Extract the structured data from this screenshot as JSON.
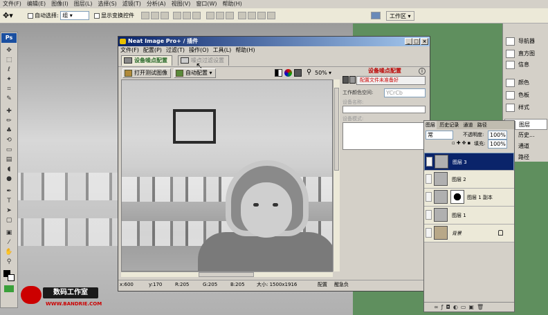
{
  "app": {
    "menu": [
      "文件(F)",
      "编辑(E)",
      "图像(I)",
      "图层(L)",
      "选择(S)",
      "滤镜(T)",
      "分析(A)",
      "视图(V)",
      "窗口(W)",
      "帮助(H)"
    ]
  },
  "options_bar": {
    "auto_select_label": "自动选择:",
    "auto_select_value": "组",
    "show_transform_label": "显示变换控件",
    "workspace_label": "工作区"
  },
  "toolbox": {
    "logo": "Ps"
  },
  "dialog": {
    "title": "Neat Image Pro+ / 插件",
    "menu": [
      "文件(F)",
      "配置(P)",
      "过滤(T)",
      "操作(O)",
      "工具(L)",
      "帮助(H)"
    ],
    "tabs": [
      {
        "label": "设备噪点配置",
        "active": true
      },
      {
        "label": "噪点过滤设置",
        "active": false
      }
    ],
    "toolbar": {
      "open_label": "打开测试图像",
      "auto_profile_label": "自动配置",
      "zoom": "50%"
    },
    "right_panel": {
      "header": "设备噪点配置",
      "status": "配置文件未准备好",
      "color_space_label": "工作颜色空间:",
      "color_space_value": "YCrCb",
      "device_name_label": "设备名称:",
      "device_mode_label": "设备模式:"
    },
    "status_bar": {
      "x": "x:600",
      "y": "y:170",
      "r": "R:205",
      "g": "G:205",
      "b": "B:205",
      "size": "大小: 1500x1916",
      "profile": "配置",
      "filter": "醒急负"
    }
  },
  "dock": {
    "items": [
      "导航器",
      "直方图",
      "信息",
      "颜色",
      "色板",
      "样式",
      "图层",
      "历史...",
      "通道",
      "路径"
    ]
  },
  "layers_panel": {
    "tabs": [
      "图层",
      "历史记录",
      "通道",
      "路径"
    ],
    "blend_mode": "常",
    "opacity_label": "不透明度:",
    "opacity": "100%",
    "fill_label": "填充:",
    "fill": "100%",
    "layers": [
      {
        "name": "图层 3",
        "selected": true
      },
      {
        "name": "图层 2",
        "selected": false
      },
      {
        "name": "图层 1 副本",
        "selected": false
      },
      {
        "name": "图层 1",
        "selected": false
      },
      {
        "name": "背景",
        "selected": false
      }
    ]
  },
  "watermark": {
    "title": "数码工作室",
    "url": "WWW.BANDRIE.COM"
  }
}
